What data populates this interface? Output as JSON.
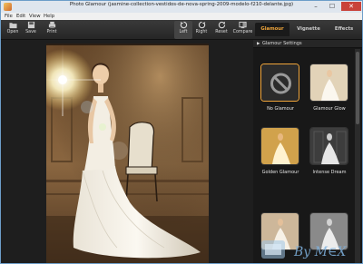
{
  "window": {
    "title": "Photo Glamour (jasmine-collection-vestidos-de-nova-spring-2009-modelo-f210-delante.jpg)",
    "controls": {
      "minimize": "–",
      "maximize": "☐",
      "close": "✕"
    }
  },
  "menu": {
    "items": [
      "File",
      "Edit",
      "View",
      "Help"
    ]
  },
  "toolbar": {
    "open": "Open",
    "save": "Save",
    "print": "Print",
    "left": "Left",
    "right": "Right",
    "reset": "Reset",
    "compare": "Compare"
  },
  "tabs": [
    "Glamour",
    "Vignette",
    "Effects"
  ],
  "tabs_active": "Glamour",
  "sidebar": {
    "heading": "Glamour Settings",
    "presets": [
      {
        "label": "No Glamour",
        "selected": true
      },
      {
        "label": "Glamour Glow",
        "selected": false
      },
      {
        "label": "Golden Glamour",
        "selected": false
      },
      {
        "label": "Intense Dream",
        "selected": false
      },
      {
        "label": "",
        "selected": false
      },
      {
        "label": "",
        "selected": false
      }
    ]
  },
  "watermark": {
    "text": "By M∈X"
  },
  "colors": {
    "accent": "#f0a53a",
    "panel": "#181818",
    "toolbar": "#2e2e2e",
    "title_bar": "#dfe6ee",
    "close": "#c9433a"
  }
}
